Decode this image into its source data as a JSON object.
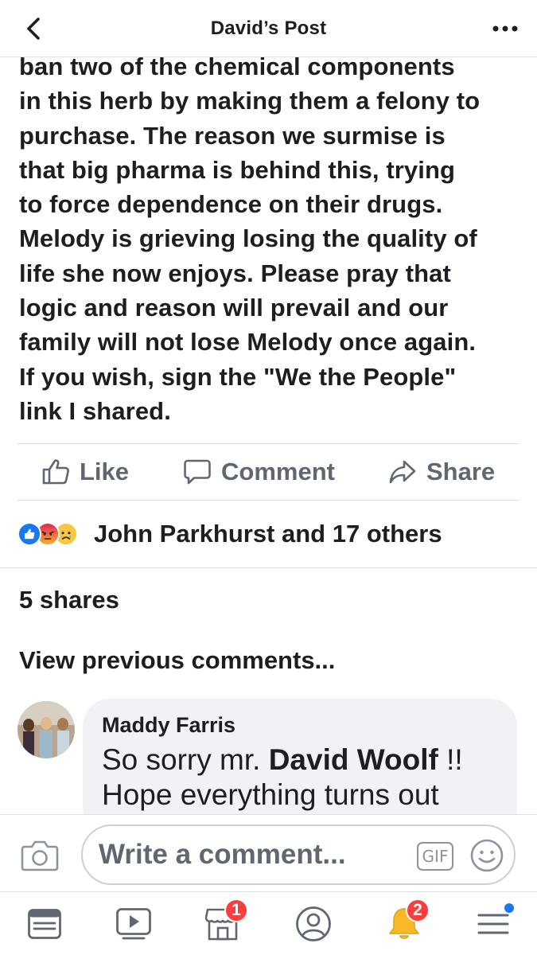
{
  "header": {
    "title": "David’s Post",
    "back_icon": "chevron-left-icon",
    "more_icon": "more-horizontal-icon"
  },
  "post": {
    "text": "ban two of the chemical components\nin this herb by making them a felony to\npurchase.  The reason we surmise is\nthat big pharma is behind this, trying\nto force dependence on their drugs.\nMelody is grieving losing the quality of\nlife she now enjoys.  Please pray that\nlogic and reason will prevail and our\nfamily will not lose Melody once again.\nIf you wish, sign the \"We the People\"\nlink I shared."
  },
  "actions": {
    "like_label": "Like",
    "comment_label": "Comment",
    "share_label": "Share"
  },
  "reactions": {
    "summary": "John Parkhurst and 17 others",
    "icons": [
      "like-reaction-icon",
      "angry-reaction-icon",
      "sad-reaction-icon"
    ]
  },
  "shares": "5 shares",
  "view_previous": "View previous comments...",
  "comment": {
    "author": "Maddy Farris",
    "text_prefix": "So sorry mr. ",
    "mention": "David Woolf",
    "text_suffix": " !!",
    "text_line2": "Hope everything turns out"
  },
  "composer": {
    "placeholder": "Write a comment...",
    "gif_label": "GIF"
  },
  "tabbar": {
    "marketplace_badge": "1",
    "notifications_badge": "2"
  },
  "colors": {
    "brand_blue": "#1877f2",
    "badge_red": "#fa3e3e",
    "secondary_text": "#606770"
  }
}
